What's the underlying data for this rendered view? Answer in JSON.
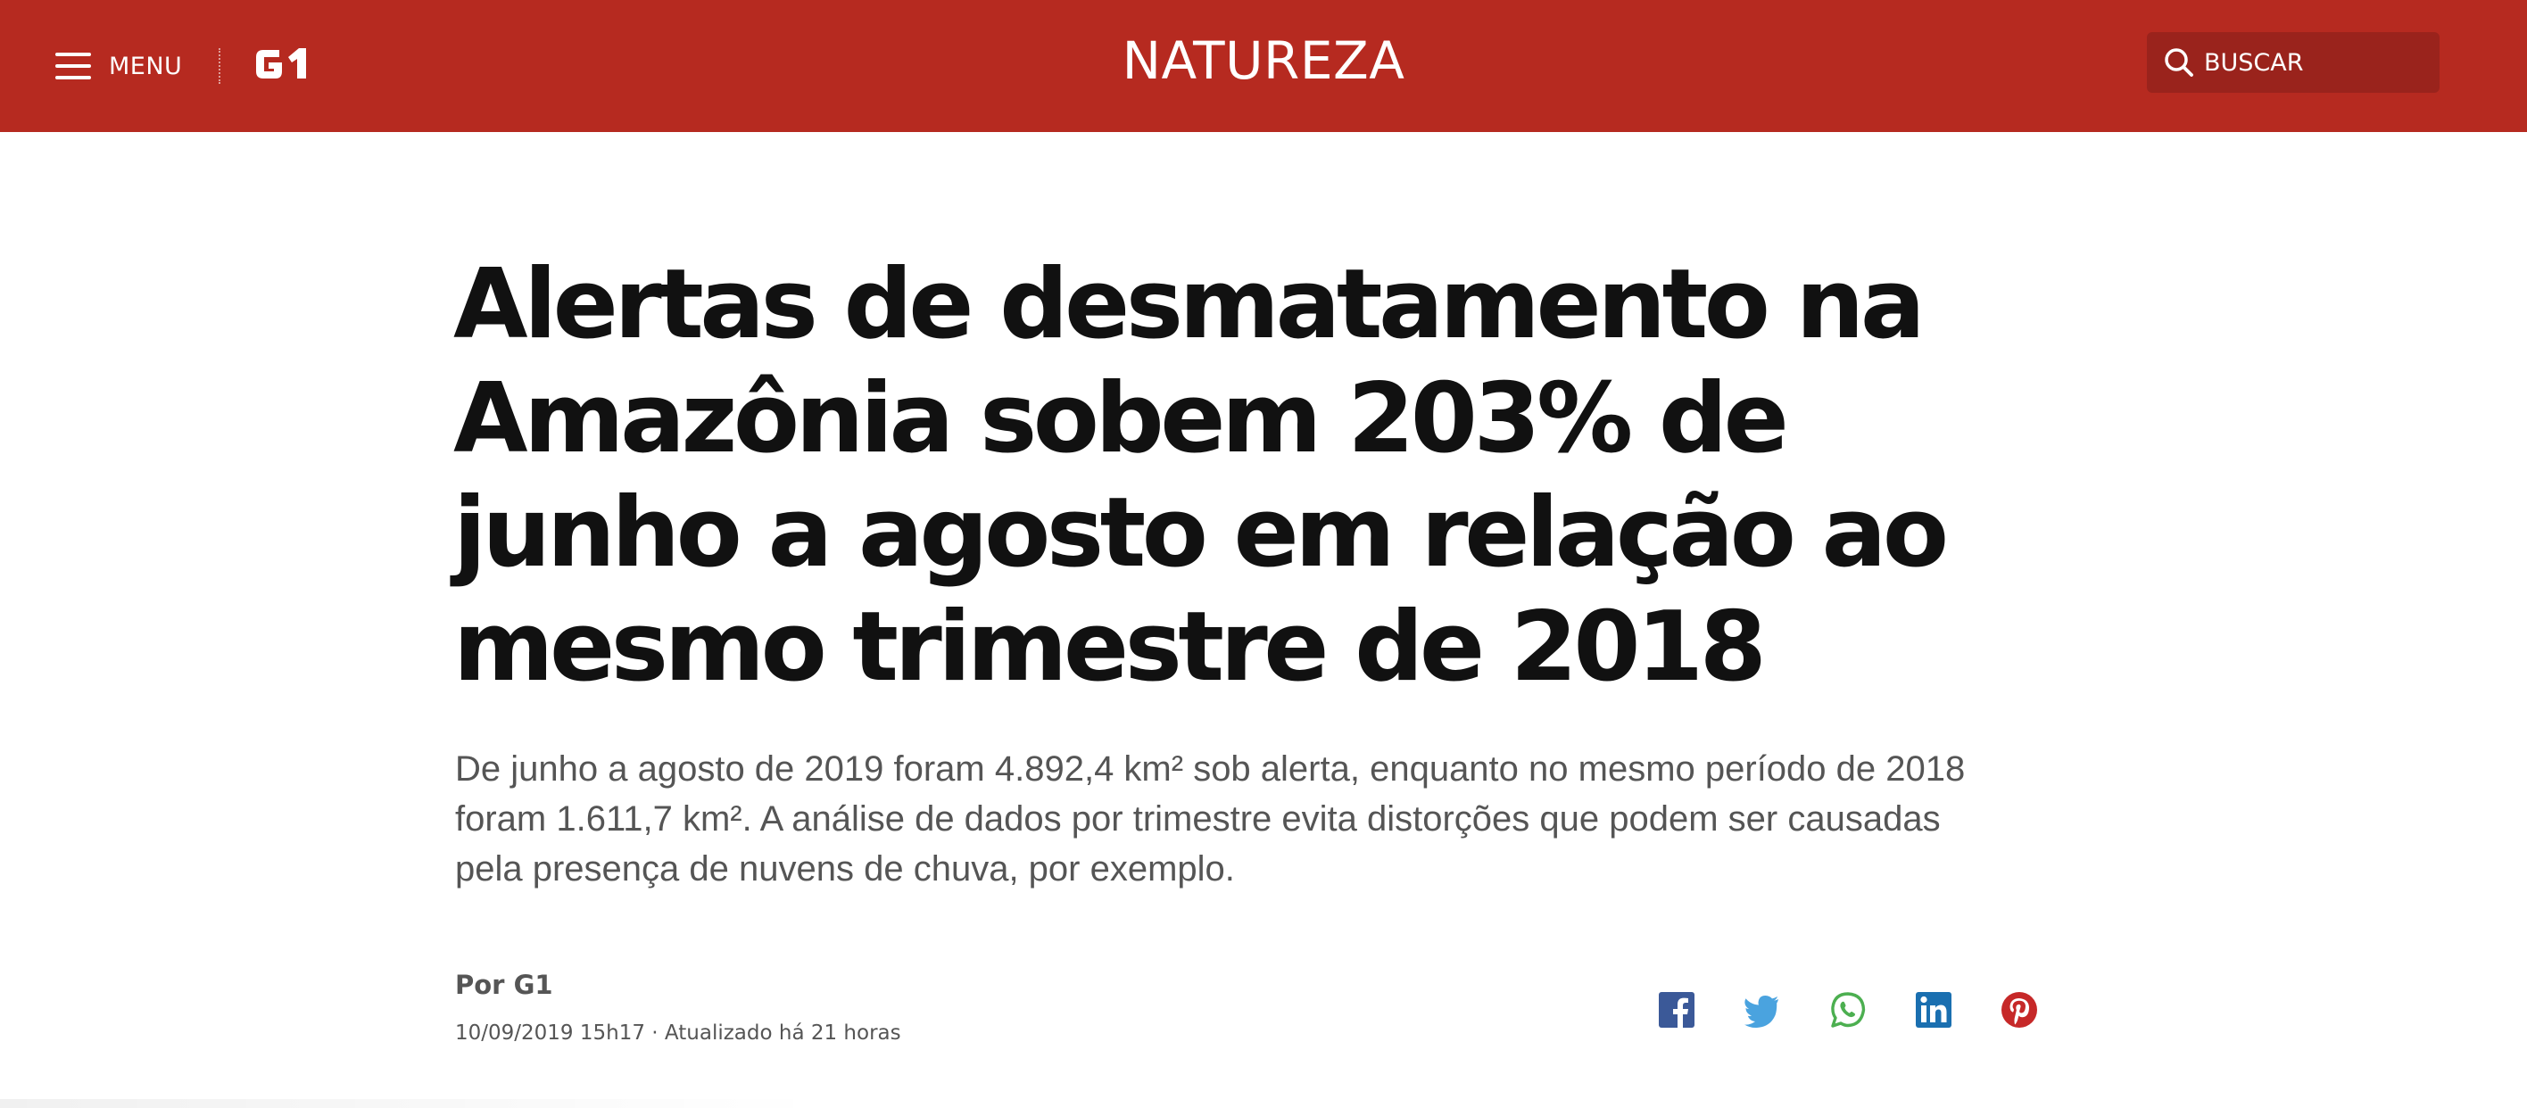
{
  "header": {
    "menu_label": "MENU",
    "logo_text": "G1",
    "section_title": "NATUREZA",
    "search_placeholder": "BUSCAR",
    "background_color": "#b62a20"
  },
  "article": {
    "headline": "Alertas de desmatamento na Amazônia sobem 203% de junho a agosto em relação ao mesmo trimestre de 2018",
    "subtitle": "De junho a agosto de 2019 foram 4.892,4 km² sob alerta, enquanto no mesmo período de 2018 foram 1.611,7 km². A análise de dados por trimestre evita distorções que podem ser causadas pela presença de nuvens de chuva, por exemplo.",
    "byline": "Por G1",
    "dateline": "10/09/2019 15h17 · Atualizado há 21 horas"
  },
  "share": {
    "icons": [
      "facebook-icon",
      "twitter-icon",
      "whatsapp-icon",
      "linkedin-icon",
      "pinterest-icon"
    ],
    "colors": {
      "facebook": "#3b5998",
      "twitter": "#4aa3df",
      "whatsapp": "#4caf50",
      "linkedin": "#1a6fb0",
      "pinterest": "#c62828"
    }
  }
}
